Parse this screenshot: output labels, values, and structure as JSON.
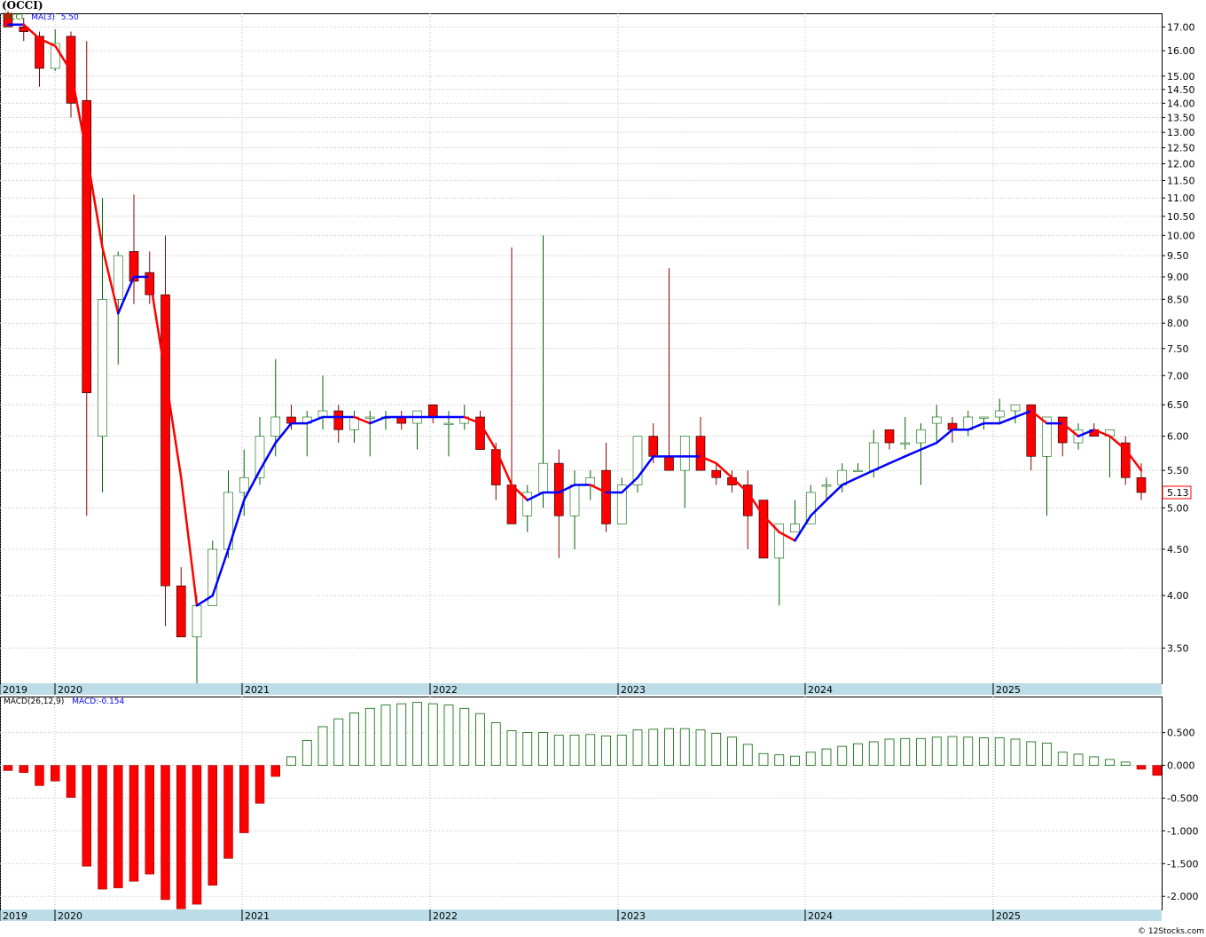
{
  "title": "(OCCI)",
  "footer": "© 12Stocks.com",
  "price_legend": {
    "ticker": "OCCI",
    "ma_label": "MA(3)",
    "ma_value": "5.50"
  },
  "macd_legend": {
    "label": "MACD(26,12,9)",
    "value_label": "MACD:-0.154"
  },
  "last_price_label": "5.13",
  "colors": {
    "up": "#ffffff",
    "up_border": "#006400",
    "down": "#ff0000",
    "ma_up": "#0000ff",
    "ma_down": "#ff0000",
    "grid": "#bfbfbf",
    "axis_band": "#bcdde7",
    "macd_pos_border": "#006400",
    "macd_neg": "#ff0000"
  },
  "chart_data": [
    {
      "type": "candlestick",
      "interval": "monthly",
      "scale": "log",
      "ylim": [
        3.2,
        17.6
      ],
      "yticks": [
        "3.50",
        "4.00",
        "4.50",
        "5.00",
        "5.50",
        "6.00",
        "6.50",
        "7.00",
        "7.50",
        "8.00",
        "8.50",
        "9.00",
        "9.50",
        "10.00",
        "10.50",
        "11.00",
        "11.50",
        "12.00",
        "12.50",
        "13.00",
        "13.50",
        "14.00",
        "14.50",
        "15.00",
        "16.00",
        "17.00"
      ],
      "xticks": [
        "2019",
        "2020",
        "2021",
        "2022",
        "2023",
        "2024",
        "2025"
      ],
      "ohlc": [
        [
          17.6,
          17.7,
          17.0,
          17.0
        ],
        [
          17.0,
          17.4,
          16.4,
          16.8
        ],
        [
          16.6,
          16.8,
          14.6,
          15.3
        ],
        [
          15.3,
          16.9,
          15.2,
          16.3
        ],
        [
          16.6,
          16.8,
          13.5,
          14.0
        ],
        [
          14.1,
          16.4,
          4.9,
          6.7
        ],
        [
          6.0,
          11.0,
          5.2,
          8.5
        ],
        [
          8.5,
          9.6,
          7.2,
          9.5
        ],
        [
          9.6,
          11.1,
          8.4,
          8.9
        ],
        [
          9.1,
          9.6,
          8.4,
          8.6
        ],
        [
          8.6,
          10.0,
          3.7,
          4.1
        ],
        [
          4.1,
          4.3,
          3.6,
          3.6
        ],
        [
          3.6,
          4.0,
          3.2,
          3.9
        ],
        [
          3.9,
          4.6,
          3.9,
          4.5
        ],
        [
          4.5,
          5.5,
          4.4,
          5.2
        ],
        [
          5.2,
          5.8,
          4.9,
          5.4
        ],
        [
          5.4,
          6.3,
          5.3,
          6.0
        ],
        [
          6.0,
          7.3,
          5.7,
          6.3
        ],
        [
          6.3,
          6.5,
          6.1,
          6.2
        ],
        [
          6.2,
          6.4,
          5.7,
          6.3
        ],
        [
          6.3,
          7.0,
          6.1,
          6.4
        ],
        [
          6.4,
          6.5,
          5.9,
          6.1
        ],
        [
          6.1,
          6.4,
          5.9,
          6.3
        ],
        [
          6.3,
          6.4,
          5.7,
          6.3
        ],
        [
          6.3,
          6.4,
          6.1,
          6.3
        ],
        [
          6.3,
          6.4,
          6.1,
          6.2
        ],
        [
          6.2,
          6.4,
          5.8,
          6.4
        ],
        [
          6.5,
          6.5,
          6.2,
          6.3
        ],
        [
          6.2,
          6.4,
          5.7,
          6.2
        ],
        [
          6.2,
          6.5,
          6.1,
          6.3
        ],
        [
          6.3,
          6.4,
          5.8,
          5.8
        ],
        [
          5.8,
          5.9,
          5.1,
          5.3
        ],
        [
          5.3,
          9.7,
          4.8,
          4.8
        ],
        [
          4.9,
          5.3,
          4.7,
          5.2
        ],
        [
          5.2,
          10.0,
          5.0,
          5.6
        ],
        [
          5.6,
          5.8,
          4.4,
          4.9
        ],
        [
          4.9,
          5.5,
          4.5,
          5.3
        ],
        [
          5.3,
          5.5,
          5.1,
          5.4
        ],
        [
          5.5,
          5.9,
          4.7,
          4.8
        ],
        [
          4.8,
          5.4,
          4.8,
          5.3
        ],
        [
          5.3,
          6.0,
          5.2,
          6.0
        ],
        [
          6.0,
          6.2,
          5.6,
          5.7
        ],
        [
          5.7,
          9.2,
          5.5,
          5.5
        ],
        [
          5.5,
          6.0,
          5.0,
          6.0
        ],
        [
          6.0,
          6.3,
          5.5,
          5.5
        ],
        [
          5.5,
          5.6,
          5.3,
          5.4
        ],
        [
          5.4,
          5.5,
          5.2,
          5.3
        ],
        [
          5.3,
          5.5,
          4.5,
          4.9
        ],
        [
          5.1,
          5.1,
          4.4,
          4.4
        ],
        [
          4.4,
          4.8,
          3.9,
          4.8
        ],
        [
          4.7,
          5.1,
          4.7,
          4.8
        ],
        [
          4.8,
          5.3,
          4.8,
          5.2
        ],
        [
          5.3,
          5.4,
          5.1,
          5.3
        ],
        [
          5.3,
          5.6,
          5.2,
          5.5
        ],
        [
          5.5,
          5.6,
          5.5,
          5.5
        ],
        [
          5.5,
          6.1,
          5.4,
          5.9
        ],
        [
          6.1,
          6.1,
          5.8,
          5.9
        ],
        [
          5.9,
          6.3,
          5.8,
          5.9
        ],
        [
          5.9,
          6.2,
          5.3,
          6.1
        ],
        [
          6.2,
          6.5,
          5.9,
          6.3
        ],
        [
          6.2,
          6.3,
          5.9,
          6.1
        ],
        [
          6.1,
          6.4,
          6.0,
          6.3
        ],
        [
          6.3,
          6.3,
          6.1,
          6.3
        ],
        [
          6.3,
          6.6,
          6.2,
          6.4
        ],
        [
          6.4,
          6.5,
          6.2,
          6.5
        ],
        [
          6.5,
          6.5,
          5.5,
          5.7
        ],
        [
          5.7,
          6.3,
          4.9,
          6.3
        ],
        [
          6.3,
          6.3,
          5.7,
          5.9
        ],
        [
          5.9,
          6.2,
          5.8,
          6.1
        ],
        [
          6.1,
          6.2,
          6.0,
          6.0
        ],
        [
          6.0,
          6.1,
          5.4,
          6.1
        ],
        [
          5.9,
          6.0,
          5.3,
          5.4
        ],
        [
          5.4,
          5.6,
          5.1,
          5.2
        ]
      ],
      "ma": [
        17.1,
        17.1,
        16.5,
        16.2,
        15.2,
        12.3,
        9.7,
        8.2,
        9.0,
        9.0,
        7.0,
        5.4,
        3.9,
        4.0,
        4.5,
        5.1,
        5.5,
        5.9,
        6.2,
        6.2,
        6.3,
        6.3,
        6.3,
        6.2,
        6.3,
        6.3,
        6.3,
        6.3,
        6.3,
        6.3,
        6.2,
        5.8,
        5.3,
        5.1,
        5.2,
        5.2,
        5.3,
        5.3,
        5.2,
        5.2,
        5.4,
        5.7,
        5.7,
        5.7,
        5.7,
        5.6,
        5.4,
        5.2,
        4.9,
        4.7,
        4.6,
        4.9,
        5.1,
        5.3,
        5.4,
        5.5,
        5.6,
        5.7,
        5.8,
        5.9,
        6.1,
        6.1,
        6.2,
        6.2,
        6.3,
        6.4,
        6.2,
        6.2,
        6.0,
        6.1,
        6.0,
        5.8,
        5.5
      ]
    },
    {
      "type": "bar",
      "label": "MACD(26,12,9)",
      "ylim": [
        -2.2,
        1.05
      ],
      "yticks": [
        "0.500",
        "0.000",
        "-0.500",
        "-1.000",
        "-1.500",
        "-2.000"
      ],
      "xticks": [
        "2019",
        "2020",
        "2021",
        "2022",
        "2023",
        "2024",
        "2025"
      ],
      "values": [
        -0.08,
        -0.11,
        -0.31,
        -0.24,
        -0.49,
        -1.54,
        -1.89,
        -1.87,
        -1.77,
        -1.66,
        -2.05,
        -2.19,
        -2.12,
        -1.83,
        -1.42,
        -1.03,
        -0.58,
        -0.17,
        0.13,
        0.38,
        0.59,
        0.71,
        0.8,
        0.87,
        0.92,
        0.94,
        0.96,
        0.94,
        0.92,
        0.87,
        0.79,
        0.65,
        0.53,
        0.5,
        0.5,
        0.46,
        0.46,
        0.47,
        0.45,
        0.46,
        0.54,
        0.55,
        0.56,
        0.56,
        0.54,
        0.49,
        0.43,
        0.32,
        0.18,
        0.16,
        0.14,
        0.2,
        0.25,
        0.29,
        0.33,
        0.36,
        0.4,
        0.41,
        0.41,
        0.43,
        0.44,
        0.43,
        0.42,
        0.42,
        0.4,
        0.36,
        0.34,
        0.2,
        0.17,
        0.13,
        0.09,
        0.05,
        -0.06,
        -0.154
      ]
    }
  ]
}
